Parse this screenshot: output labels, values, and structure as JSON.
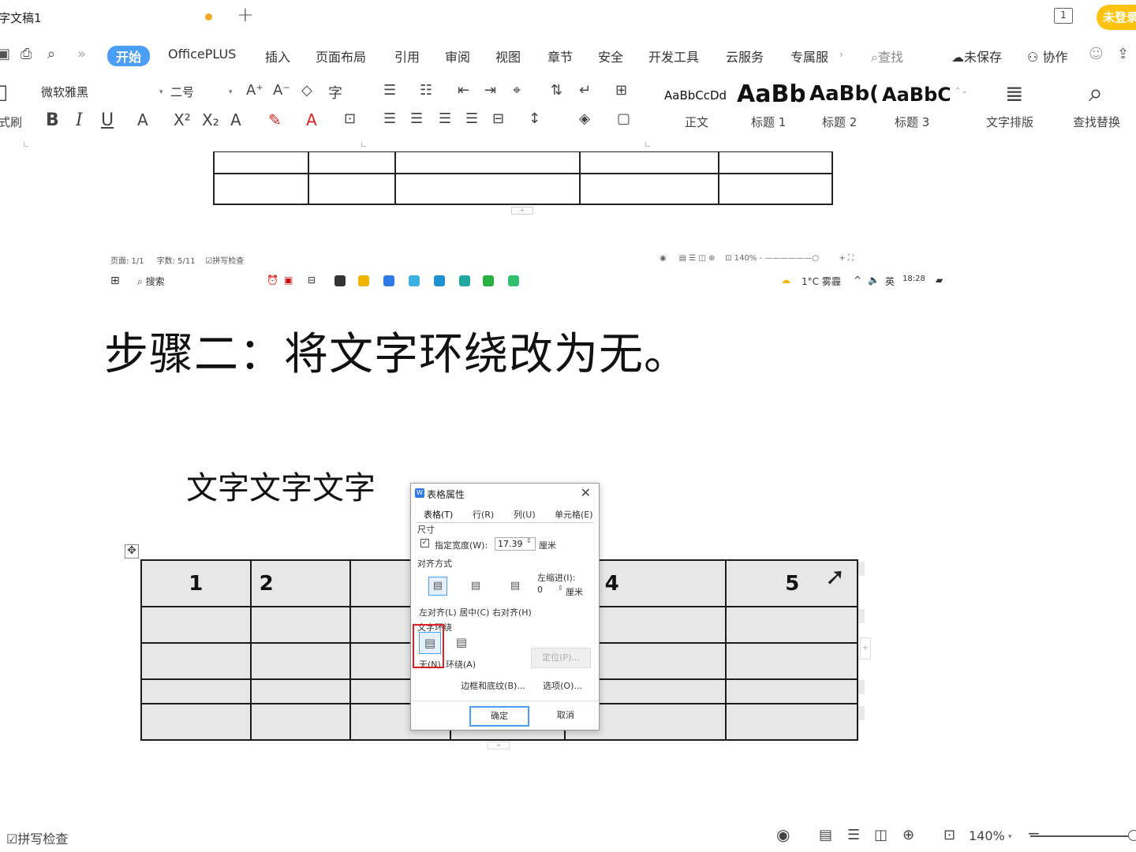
{
  "tabbar": {
    "doc_title": "字文稿1",
    "plus": "+",
    "window_count": "1",
    "login": "未登录"
  },
  "menu": {
    "more": "»",
    "items": [
      "开始",
      "OfficePLUS",
      "插入",
      "页面布局",
      "引用",
      "审阅",
      "视图",
      "章节",
      "安全",
      "开发工具",
      "云服务",
      "专属服"
    ],
    "search": "查找",
    "unsaved": "未保存",
    "collab": "协作"
  },
  "ribbon": {
    "format_painter": "式刷",
    "font_name": "微软雅黑",
    "font_size": "二号",
    "styles": [
      {
        "sample": "AaBbCcDd",
        "label": "正文"
      },
      {
        "sample": "AaBb",
        "label": "标题 1"
      },
      {
        "sample": "AaBb(",
        "label": "标题 2"
      },
      {
        "sample": "AaBbC",
        "label": "标题 3"
      }
    ],
    "text_layout": "文字排版",
    "find_replace": "查找替换"
  },
  "inner_status": {
    "page": "页面: 1/1",
    "words": "字数: 5/11",
    "spell": "拼写检查",
    "zoom": "140%"
  },
  "taskbar": {
    "search": "搜索",
    "weather": "1°C 雾霾",
    "lang": "英",
    "time": "18:28"
  },
  "step_title": "步骤二：将文字环绕改为无。",
  "doc_text": "文字文字文字",
  "table": {
    "header": [
      "1",
      "2",
      "",
      "",
      "4",
      "5"
    ]
  },
  "dialog": {
    "title": "表格属性",
    "tabs": [
      "表格(T)",
      "行(R)",
      "列(U)",
      "单元格(E)"
    ],
    "size_label": "尺寸",
    "width_label": "指定宽度(W):",
    "width_value": "17.39",
    "width_unit": "厘米",
    "align_label": "对齐方式",
    "indent_label": "左缩进(I):",
    "indent_value": "0",
    "indent_unit": "厘米",
    "align_options": "左对齐(L) 居中(C) 右对齐(H)",
    "wrap_label": "文字环绕",
    "wrap_none": "无(N)",
    "wrap_around": "环绕(A)",
    "position_btn": "定位(P)...",
    "borders_btn": "边框和底纹(B)...",
    "options_btn": "选项(O)...",
    "ok": "确定",
    "cancel": "取消",
    "highlight_color": "#e02020"
  },
  "statusbar": {
    "spell": "拼写检查",
    "zoom": "140%"
  }
}
